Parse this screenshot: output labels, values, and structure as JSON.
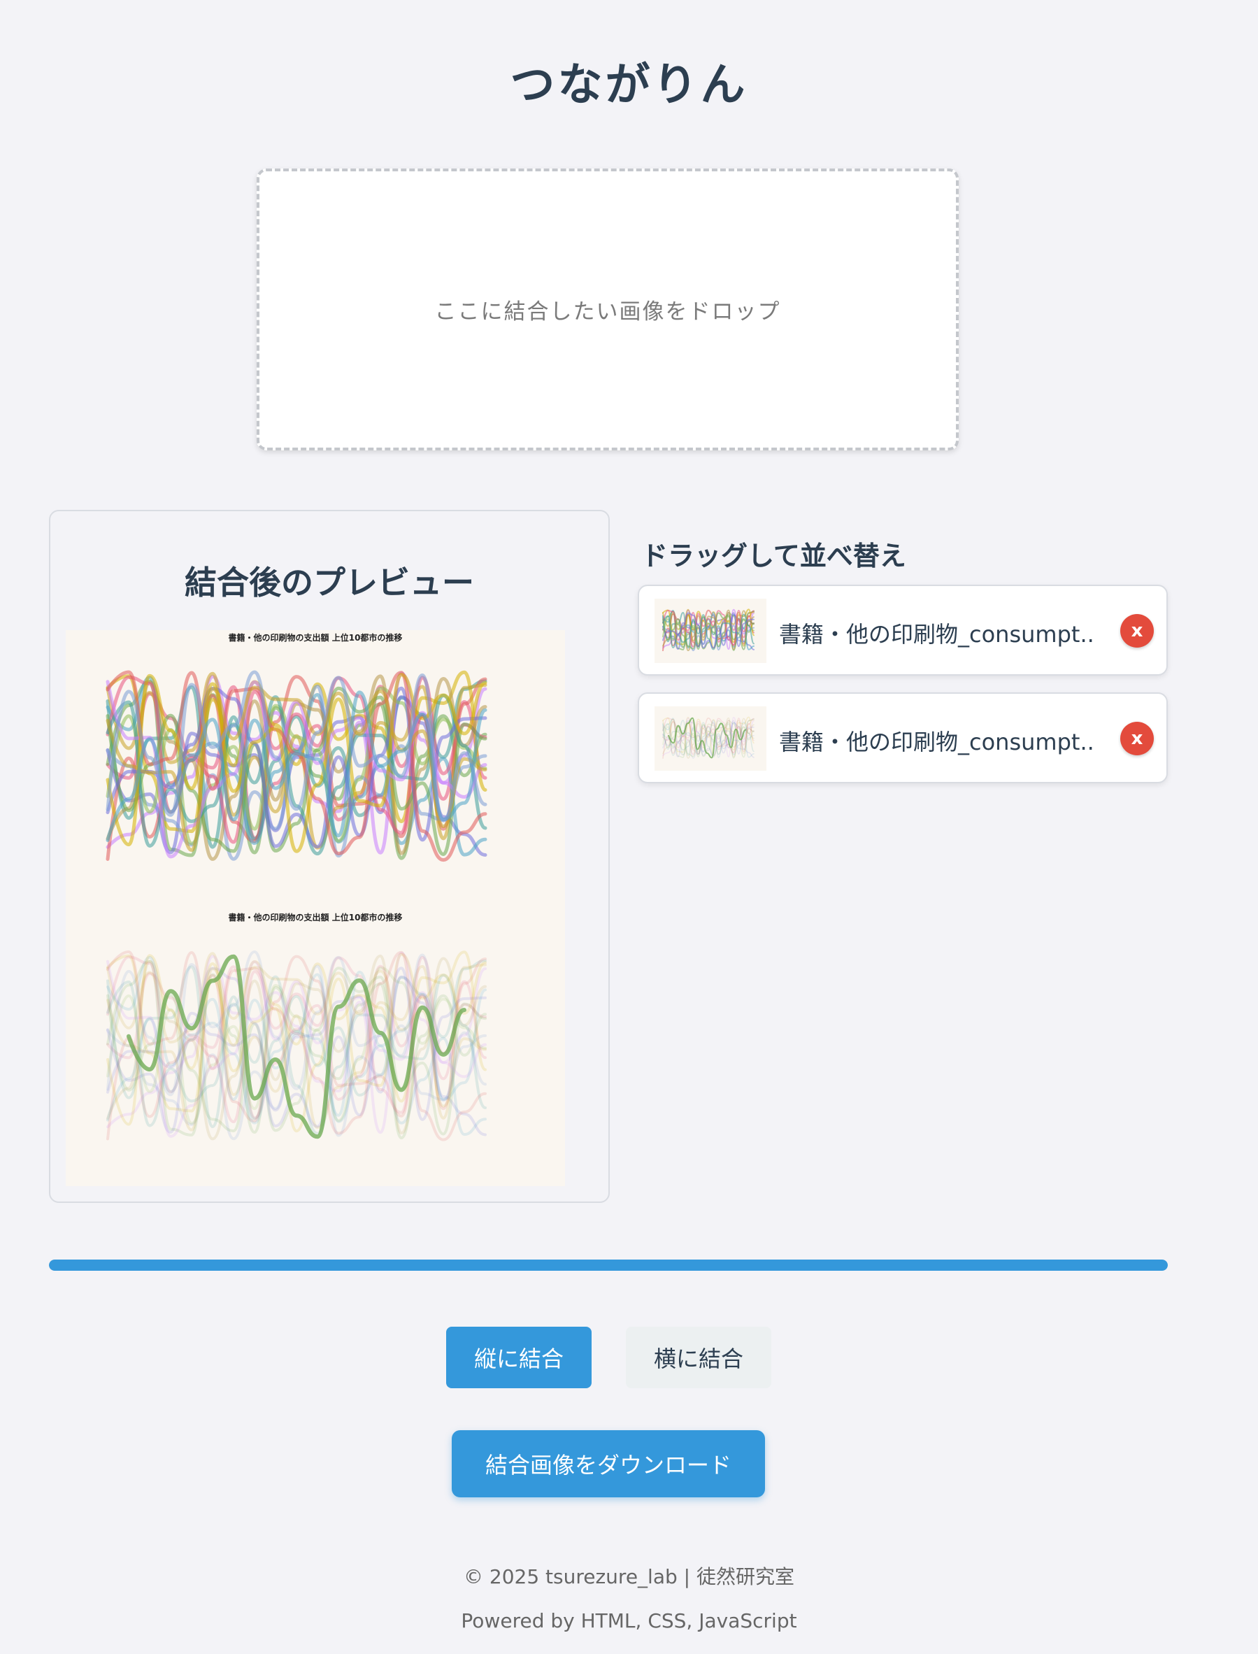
{
  "app": {
    "title": "つながりん"
  },
  "dropzone": {
    "text": "ここに結合したい画像をドロップ"
  },
  "preview": {
    "heading": "結合後のプレビュー",
    "images": [
      {
        "chart_title": "書籍・他の印刷物の支出額 上位10都市の推移",
        "highlight": "all"
      },
      {
        "chart_title": "書籍・他の印刷物の支出額 上位10都市の推移",
        "highlight": "東京都区部"
      }
    ]
  },
  "reorder": {
    "heading": "ドラッグして並べ替え",
    "items": [
      {
        "name": "書籍・他の印刷物_consumpt..",
        "delete_label": "x",
        "thumbnail": "chart-all-lines"
      },
      {
        "name": "書籍・他の印刷物_consumpt..",
        "delete_label": "x",
        "thumbnail": "chart-highlight-line"
      }
    ]
  },
  "progress": {
    "value": 1.0,
    "color": "#3498db"
  },
  "buttons": {
    "vertical": "縦に結合",
    "horizontal": "横に結合",
    "download": "結合画像をダウンロード"
  },
  "footer": {
    "copyright": "© 2025 tsurezure_lab | 徒然研究室",
    "powered": "Powered by HTML, CSS, JavaScript"
  },
  "colors": {
    "primary": "#3498db",
    "danger": "#e34b3c",
    "text": "#2c3e50",
    "background": "#f3f3f7"
  }
}
